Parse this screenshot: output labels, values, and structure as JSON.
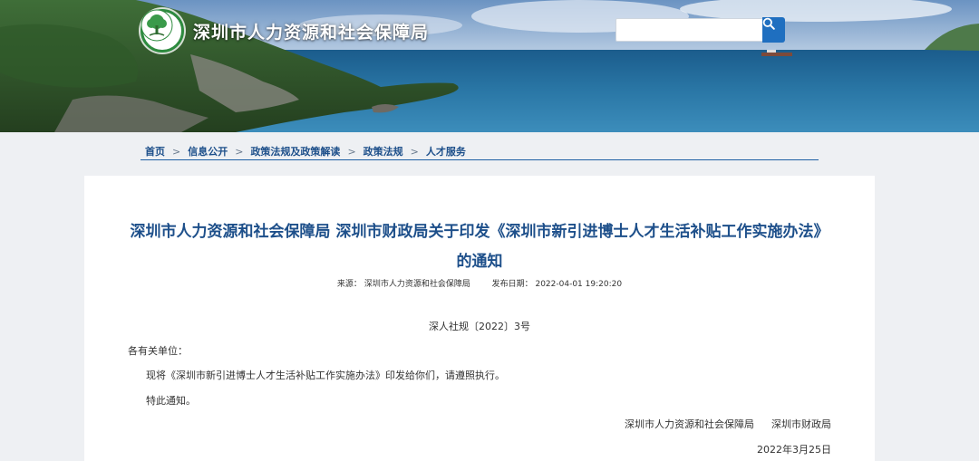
{
  "header": {
    "site_title": "深圳市人力资源和社会保障局",
    "logo": "tree-emblem-logo",
    "search": {
      "placeholder": "",
      "button_icon": "search-icon"
    }
  },
  "breadcrumb": {
    "items": [
      "首页",
      "信息公开",
      "政策法规及政策解读",
      "政策法规",
      "人才服务"
    ],
    "separator": ">"
  },
  "article": {
    "title_line1": "深圳市人力资源和社会保障局 深圳市财政局关于印发《深圳市新引进博士人才生活补贴工作实施办法》",
    "title_line2": "的通知",
    "source_label": "来源：",
    "source_value": "深圳市人力资源和社会保障局",
    "date_label": "发布日期：",
    "date_value": "2022-04-01 19:20:20",
    "doc_number": "深人社规〔2022〕3号",
    "salutation": "各有关单位：",
    "body": "现将《深圳市新引进博士人才生活补贴工作实施办法》印发给你们，请遵照执行。",
    "notice": "特此通知。",
    "signers": [
      "深圳市人力资源和社会保障局",
      "深圳市财政局"
    ],
    "sign_date": "2022年3月25日"
  },
  "colors": {
    "title_blue": "#1d4f8a",
    "search_button": "#1f6fc0",
    "logo_green": "#2e8b3f",
    "page_bg": "#eef0f3"
  }
}
